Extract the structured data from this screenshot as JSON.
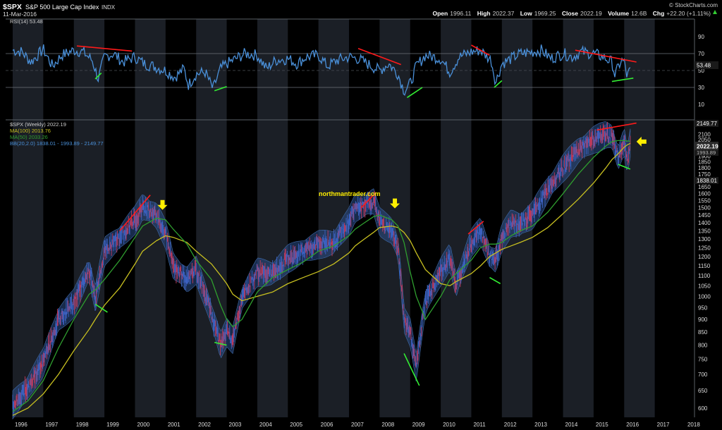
{
  "header": {
    "ticker": "$SPX",
    "name": "S&P 500 Large Cap Index",
    "exchange": "INDX",
    "date": "11-Mar-2016",
    "brand": "© StockCharts.com",
    "open_label": "Open",
    "open": "1996.11",
    "high_label": "High",
    "high": "2022.37",
    "low_label": "Low",
    "low": "1969.25",
    "close_label": "Close",
    "close": "2022.19",
    "volume_label": "Volume",
    "volume": "12.6B",
    "chg_label": "Chg",
    "chg": "+22.20 (+1.11%)"
  },
  "watermark": "northmantrader.com",
  "colors": {
    "price": "#3d63c4",
    "rsi": "#4a90d9",
    "ma100": "#c8c020",
    "ma50": "#2f9e2f",
    "bb": "#2c4f8a",
    "trend_red": "#ff1a1a",
    "trend_green": "#33ee33",
    "arrow": "#ffee00"
  },
  "chart_data": [
    {
      "type": "line",
      "panel": "rsi",
      "legend": "RSI(14) 53.48",
      "current": "53.48",
      "ylim": [
        0,
        100
      ],
      "ticks": [
        10,
        30,
        50,
        70,
        90
      ],
      "reference_lines": [
        30,
        70
      ],
      "x": [
        1996.0,
        1996.3,
        1996.6,
        1997.0,
        1997.3,
        1997.6,
        1998.0,
        1998.3,
        1998.6,
        1998.8,
        1999.0,
        1999.3,
        1999.6,
        2000.0,
        2000.3,
        2000.6,
        2001.0,
        2001.3,
        2001.6,
        2001.75,
        2002.0,
        2002.3,
        2002.55,
        2002.8,
        2003.0,
        2003.3,
        2003.6,
        2004.0,
        2004.3,
        2004.6,
        2005.0,
        2005.3,
        2005.6,
        2006.0,
        2006.3,
        2006.6,
        2007.0,
        2007.3,
        2007.6,
        2008.0,
        2008.3,
        2008.6,
        2008.8,
        2009.0,
        2009.2,
        2009.5,
        2010.0,
        2010.3,
        2010.6,
        2011.0,
        2011.3,
        2011.65,
        2011.8,
        2012.0,
        2012.3,
        2012.6,
        2013.0,
        2013.3,
        2013.6,
        2014.0,
        2014.3,
        2014.6,
        2015.0,
        2015.3,
        2015.6,
        2015.7,
        2015.9,
        2016.0,
        2016.1,
        2016.2
      ],
      "values": [
        74,
        72,
        60,
        75,
        55,
        68,
        74,
        72,
        62,
        40,
        66,
        70,
        60,
        66,
        58,
        55,
        50,
        42,
        52,
        33,
        46,
        48,
        28,
        52,
        58,
        64,
        70,
        68,
        52,
        62,
        64,
        58,
        66,
        68,
        55,
        62,
        66,
        64,
        58,
        50,
        58,
        46,
        26,
        34,
        55,
        68,
        64,
        48,
        66,
        72,
        74,
        62,
        36,
        58,
        64,
        70,
        72,
        74,
        64,
        70,
        66,
        72,
        70,
        66,
        60,
        44,
        62,
        60,
        42,
        53.48
      ]
    },
    {
      "type": "line",
      "panel": "price",
      "legend": {
        "price": "$SPX (Weekly) 2022.19",
        "ma100": "MA(100) 2013.76",
        "ma50": "MA(50) 2033.26",
        "bb": "BB(20,2.0) 1838.01 - 1993.89 - 2149.77"
      },
      "price_tags": {
        "upper": "2149.77",
        "close": "2022.19",
        "middle": "1993.89",
        "lower": "1838.01"
      },
      "y_scale": "log",
      "ylim": [
        575,
        2200
      ],
      "y_ticks": [
        600,
        650,
        700,
        750,
        800,
        850,
        900,
        950,
        1000,
        1050,
        1100,
        1150,
        1200,
        1250,
        1300,
        1350,
        1400,
        1450,
        1500,
        1550,
        1600,
        1650,
        1700,
        1750,
        1800,
        1850,
        1900,
        1950,
        2000,
        2050,
        2100
      ],
      "x_ticks": [
        "1996",
        "1997",
        "1998",
        "1999",
        "2000",
        "2001",
        "2002",
        "2003",
        "2004",
        "2005",
        "2006",
        "2007",
        "2008",
        "2009",
        "2010",
        "2011",
        "2012",
        "2013",
        "2014",
        "2015",
        "2016",
        "2017",
        "2018"
      ],
      "x": [
        1996.0,
        1996.5,
        1997.0,
        1997.5,
        1998.0,
        1998.5,
        1998.7,
        1999.0,
        1999.5,
        2000.0,
        2000.25,
        2000.7,
        2001.0,
        2001.25,
        2001.7,
        2002.0,
        2002.5,
        2002.8,
        2003.0,
        2003.2,
        2003.5,
        2004.0,
        2004.5,
        2005.0,
        2005.5,
        2006.0,
        2006.5,
        2007.0,
        2007.2,
        2007.5,
        2007.8,
        2008.0,
        2008.4,
        2008.6,
        2008.8,
        2009.0,
        2009.2,
        2009.5,
        2010.0,
        2010.3,
        2010.5,
        2011.0,
        2011.3,
        2011.6,
        2011.8,
        2012.0,
        2012.3,
        2012.6,
        2013.0,
        2013.5,
        2014.0,
        2014.5,
        2015.0,
        2015.4,
        2015.6,
        2015.8,
        2016.0,
        2016.1,
        2016.2
      ],
      "series": [
        {
          "key": "price",
          "values": [
            610,
            660,
            740,
            900,
            970,
            1130,
            985,
            1230,
            1310,
            1420,
            1510,
            1450,
            1330,
            1150,
            1080,
            1130,
            920,
            800,
            850,
            820,
            990,
            1120,
            1110,
            1190,
            1230,
            1270,
            1280,
            1410,
            1500,
            1520,
            1550,
            1410,
            1350,
            1250,
            900,
            850,
            720,
            970,
            1120,
            1200,
            1050,
            1280,
            1350,
            1200,
            1180,
            1310,
            1400,
            1390,
            1450,
            1630,
            1800,
            1950,
            2050,
            2100,
            2080,
            1880,
            2040,
            1860,
            2022.19
          ]
        },
        {
          "key": "ma50",
          "values": [
            590,
            620,
            680,
            790,
            900,
            1010,
            1030,
            1080,
            1180,
            1310,
            1380,
            1430,
            1420,
            1360,
            1270,
            1180,
            1080,
            960,
            900,
            870,
            900,
            1020,
            1090,
            1130,
            1170,
            1230,
            1260,
            1320,
            1360,
            1400,
            1440,
            1450,
            1420,
            1380,
            1280,
            1120,
            1000,
            900,
            1000,
            1080,
            1110,
            1180,
            1250,
            1270,
            1270,
            1280,
            1320,
            1350,
            1380,
            1470,
            1600,
            1750,
            1890,
            1990,
            2030,
            2040,
            2040,
            2036,
            2033.26
          ]
        },
        {
          "key": "ma100",
          "values": [
            580,
            600,
            640,
            700,
            780,
            860,
            900,
            960,
            1040,
            1160,
            1230,
            1290,
            1320,
            1310,
            1280,
            1230,
            1160,
            1100,
            1060,
            1010,
            980,
            1000,
            1020,
            1060,
            1090,
            1120,
            1160,
            1220,
            1260,
            1300,
            1340,
            1370,
            1380,
            1370,
            1340,
            1290,
            1220,
            1130,
            1060,
            1050,
            1070,
            1110,
            1150,
            1200,
            1220,
            1240,
            1260,
            1280,
            1310,
            1370,
            1460,
            1560,
            1680,
            1800,
            1870,
            1920,
            1980,
            2000,
            2013.76
          ]
        }
      ]
    }
  ]
}
